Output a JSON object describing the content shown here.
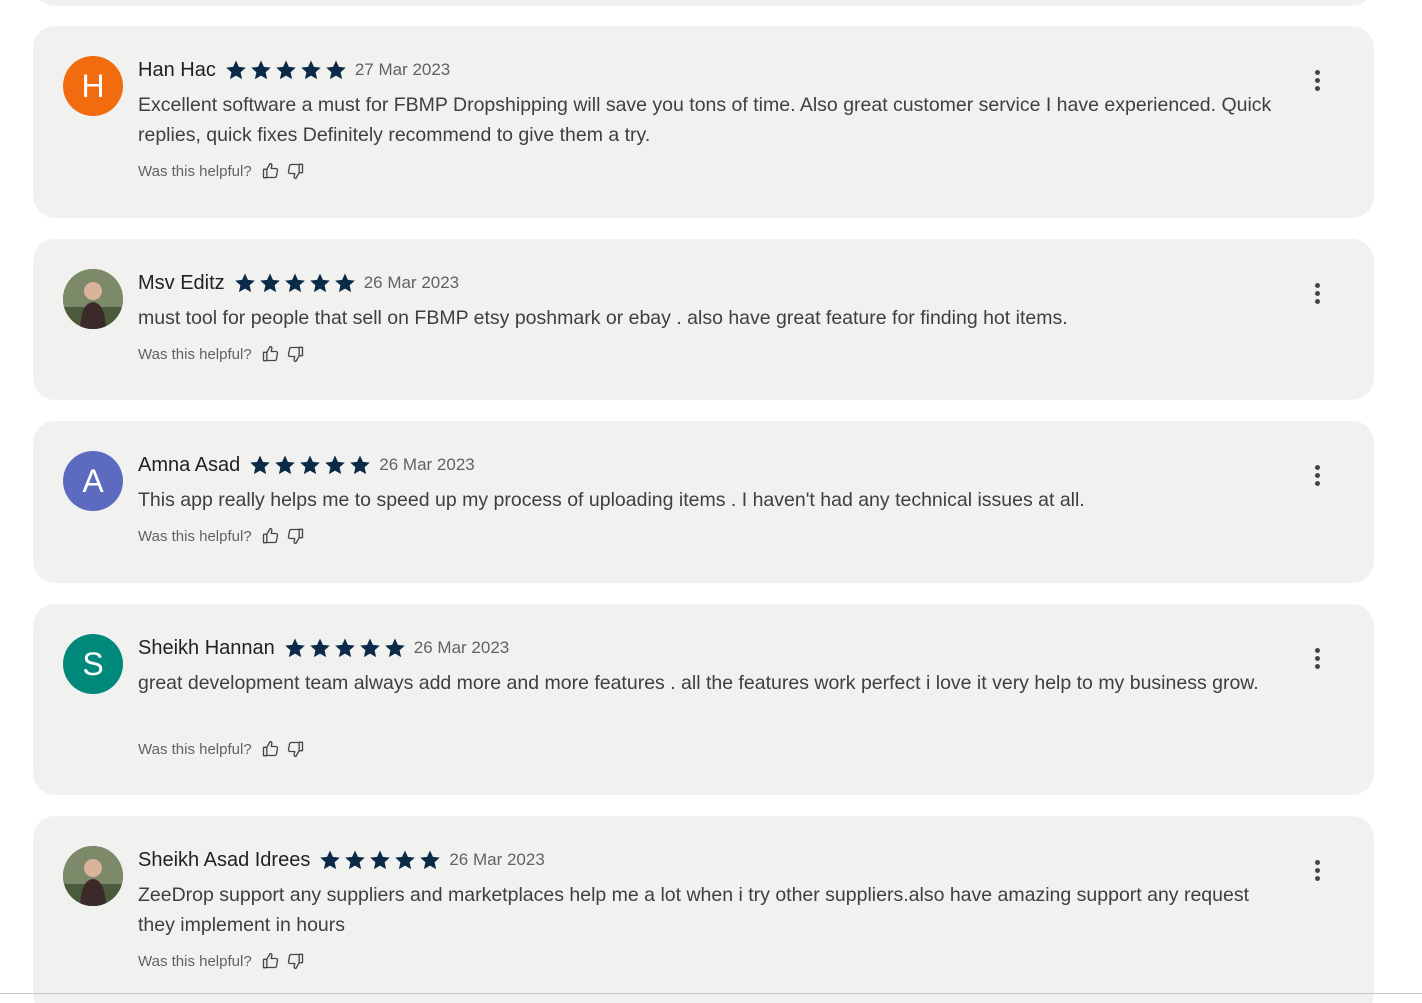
{
  "helpful_label": "Was this helpful?",
  "star_color": "#0b2a47",
  "reviews": [
    {
      "name": "Han Hac",
      "avatar_letter": "H",
      "avatar_color": "#f26b0f",
      "rating": 5,
      "date": "27 Mar 2023",
      "text": "Excellent software a must for FBMP Dropshipping will save you tons of time. Also great customer service I have experienced. Quick replies, quick fixes  Definitely recommend to give them a try."
    },
    {
      "name": "Msv Editz",
      "avatar_letter": "",
      "avatar_color": "#5b7a4a",
      "rating": 5,
      "date": "26 Mar 2023",
      "text": "must tool for people that sell on FBMP etsy poshmark or ebay . also have great feature for finding hot items."
    },
    {
      "name": "Amna Asad",
      "avatar_letter": "A",
      "avatar_color": "#5c6bc0",
      "rating": 5,
      "date": "26 Mar 2023",
      "text": "This app really helps me to speed up my process of uploading items . I haven't had any technical issues at all."
    },
    {
      "name": "Sheikh Hannan",
      "avatar_letter": "S",
      "avatar_color": "#00897b",
      "rating": 5,
      "date": "26 Mar 2023",
      "text": "great development team always add more and more features . all the features work perfect i love it very help to my business grow."
    },
    {
      "name": "Sheikh Asad Idrees",
      "avatar_letter": "",
      "avatar_color": "#6d5a4a",
      "rating": 5,
      "date": "26 Mar 2023",
      "text": "ZeeDrop support any suppliers and marketplaces help me a lot when i try other suppliers.also have amazing support any request they implement in hours"
    }
  ]
}
